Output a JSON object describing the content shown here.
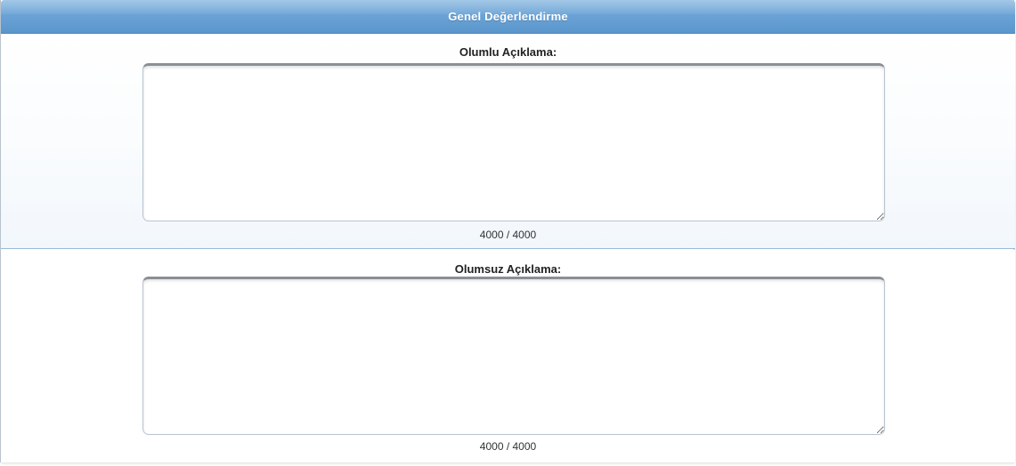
{
  "panel": {
    "title": "Genel Değerlendirme"
  },
  "positive": {
    "label": "Olumlu Açıklama:",
    "value": "",
    "counter": "4000 / 4000"
  },
  "negative": {
    "label": "Olumsuz Açıklama:",
    "value": "",
    "counter": "4000 / 4000"
  },
  "colors": {
    "header_blue": "#6aa3d6",
    "divider_blue": "#9bbbd8"
  }
}
